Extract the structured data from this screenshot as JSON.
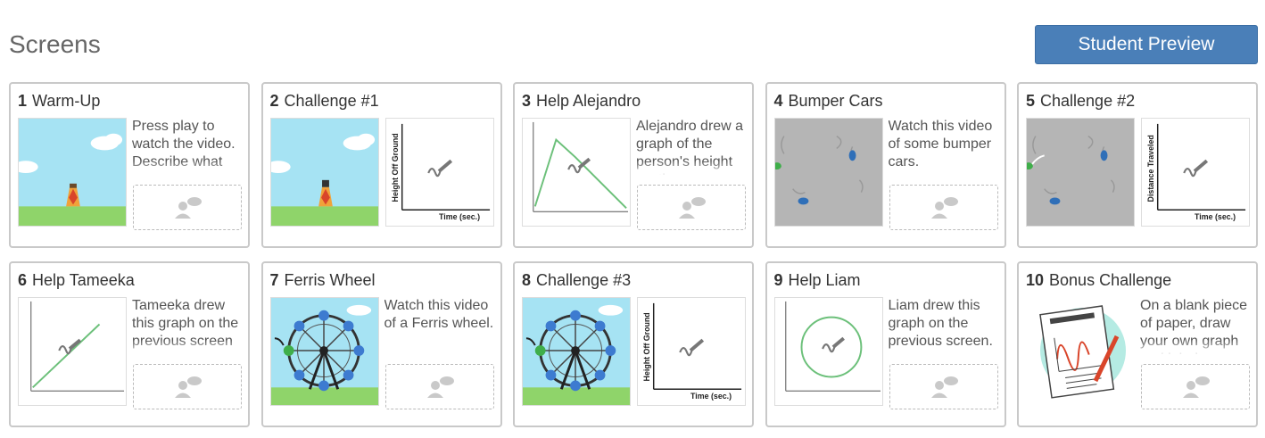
{
  "header": {
    "title": "Screens",
    "preview_button": "Student Preview"
  },
  "colors": {
    "accent": "#4a7fb8",
    "sky": "#a6e3f3",
    "grass": "#8fd46a",
    "graph_line": "#6cc07a",
    "bumper_floor": "#b5b5b5"
  },
  "screens": [
    {
      "number": "1",
      "title": "Warm-Up",
      "thumb": "sky-tower-icon",
      "text": "Press play to watch the video. Describe what"
    },
    {
      "number": "2",
      "title": "Challenge #1",
      "thumb": "sky-tower-icon",
      "graph_ylabel": "Height Off Ground",
      "graph_xlabel": "Time (sec.)"
    },
    {
      "number": "3",
      "title": "Help Alejandro",
      "thumb": "graph-peak-icon",
      "text": "Alejandro drew a graph of the person's height vs. time"
    },
    {
      "number": "4",
      "title": "Bumper Cars",
      "thumb": "bumper-cars-icon",
      "text": "Watch this video of some bumper cars."
    },
    {
      "number": "5",
      "title": "Challenge #2",
      "thumb": "bumper-cars-icon",
      "graph_ylabel": "Distance Traveled",
      "graph_xlabel": "Time (sec.)"
    },
    {
      "number": "6",
      "title": "Help Tameeka",
      "thumb": "graph-line-icon",
      "text": "Tameeka drew this graph on the previous screen"
    },
    {
      "number": "7",
      "title": "Ferris Wheel",
      "thumb": "ferris-wheel-icon",
      "text": "Watch this video of a Ferris wheel."
    },
    {
      "number": "8",
      "title": "Challenge #3",
      "thumb": "ferris-wheel-icon",
      "graph_ylabel": "Height Off Ground",
      "graph_xlabel": "Time (sec.)"
    },
    {
      "number": "9",
      "title": "Help Liam",
      "thumb": "graph-circle-icon",
      "text": "Liam drew this graph on the previous screen."
    },
    {
      "number": "10",
      "title": "Bonus Challenge",
      "thumb": "paper-pencil-icon",
      "text": "On a blank piece of paper, draw your own graph and label"
    }
  ]
}
